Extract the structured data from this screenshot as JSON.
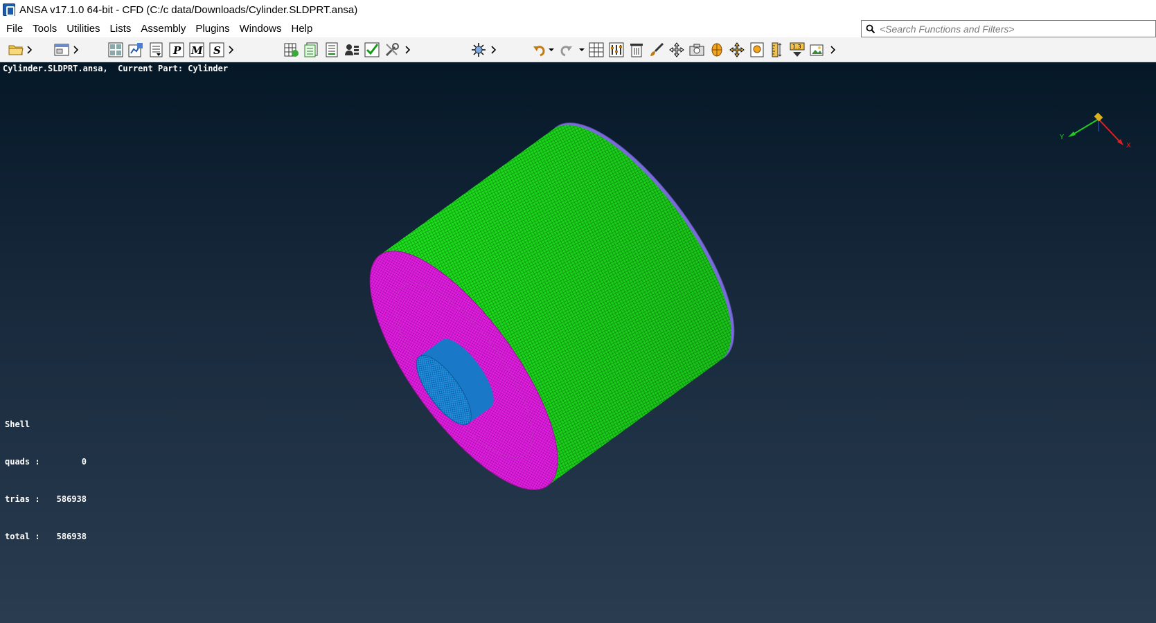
{
  "window": {
    "title": "ANSA v17.1.0 64-bit - CFD (C:/c data/Downloads/Cylinder.SLDPRT.ansa)"
  },
  "menu": {
    "items": [
      "File",
      "Tools",
      "Utilities",
      "Lists",
      "Assembly",
      "Plugins",
      "Windows",
      "Help"
    ]
  },
  "search": {
    "placeholder": "<Search Functions and Filters>"
  },
  "viewport": {
    "status_line": "Cylinder.SLDPRT.ansa,  Current Part: Cylinder",
    "stats": {
      "title": "Shell",
      "quads_label": "quads :",
      "quads_value": "0",
      "trias_label": "trias :",
      "trias_value": "586938",
      "total_label": "total :",
      "total_value": "586938"
    },
    "axis": {
      "x": "X",
      "y": "Y"
    }
  },
  "colors": {
    "cylinder_body": "#22dd22",
    "front_face": "#e020e0",
    "back_face": "#7a6cd6",
    "boss": "#1e90e0",
    "bg_top": "#051828",
    "bg_bottom": "#2a3c50"
  },
  "toolbar": {
    "icons": [
      "open-folder-icon",
      "window-icon",
      "show-hide-icon",
      "pick-icon",
      "list-icon",
      "p-icon",
      "m-icon",
      "s-icon",
      "mesh-icon",
      "connections-icon",
      "report-icon",
      "users-icon",
      "check-icon",
      "tools-icon",
      "transform-icon",
      "undo-icon",
      "redo-icon",
      "grid-icon",
      "bars-icon",
      "delete-icon",
      "brush-icon",
      "move-icon",
      "camera-icon",
      "cube-icon",
      "fit-icon",
      "screen-icon",
      "ruler-icon",
      "scale-icon",
      "image-icon"
    ]
  }
}
